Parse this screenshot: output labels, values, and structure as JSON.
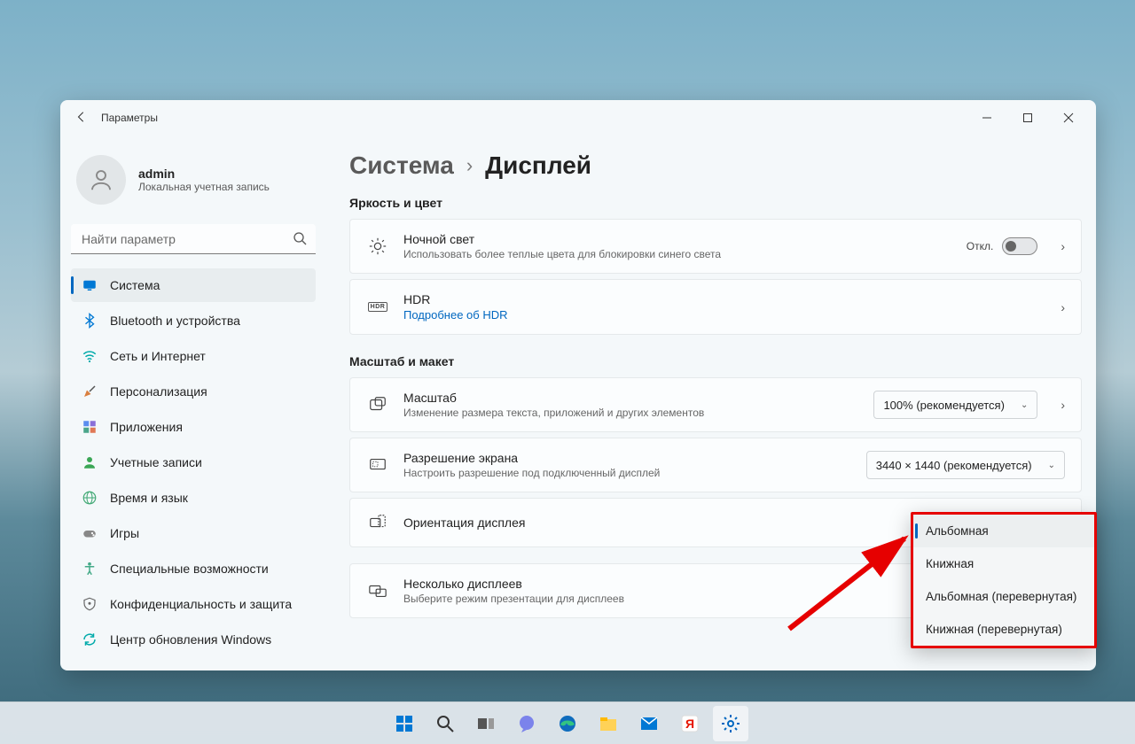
{
  "window": {
    "title": "Параметры"
  },
  "user": {
    "name": "admin",
    "subtitle": "Локальная учетная запись"
  },
  "search": {
    "placeholder": "Найти параметр"
  },
  "nav": [
    {
      "label": "Система",
      "icon": "display",
      "active": true
    },
    {
      "label": "Bluetooth и устройства",
      "icon": "bluetooth"
    },
    {
      "label": "Сеть и Интернет",
      "icon": "wifi"
    },
    {
      "label": "Персонализация",
      "icon": "brush"
    },
    {
      "label": "Приложения",
      "icon": "apps"
    },
    {
      "label": "Учетные записи",
      "icon": "person"
    },
    {
      "label": "Время и язык",
      "icon": "globe"
    },
    {
      "label": "Игры",
      "icon": "gamepad"
    },
    {
      "label": "Специальные возможности",
      "icon": "accessibility"
    },
    {
      "label": "Конфиденциальность и защита",
      "icon": "shield"
    },
    {
      "label": "Центр обновления Windows",
      "icon": "update"
    }
  ],
  "breadcrumb": {
    "parent": "Система",
    "current": "Дисплей"
  },
  "sections": {
    "brightness": "Яркость и цвет",
    "scale": "Масштаб и макет"
  },
  "cards": {
    "nightlight": {
      "title": "Ночной свет",
      "desc": "Использовать более теплые цвета для блокировки синего света",
      "state": "Откл."
    },
    "hdr": {
      "title": "HDR",
      "link": "Подробнее об HDR"
    },
    "scale": {
      "title": "Масштаб",
      "desc": "Изменение размера текста, приложений и других элементов",
      "value": "100% (рекомендуется)"
    },
    "resolution": {
      "title": "Разрешение экрана",
      "desc": "Настроить разрешение под подключенный дисплей",
      "value": "3440 × 1440 (рекомендуется)"
    },
    "orientation": {
      "title": "Ориентация дисплея"
    },
    "multi": {
      "title": "Несколько дисплеев",
      "desc": "Выберите режим презентации для дисплеев"
    }
  },
  "orientation_options": [
    "Альбомная",
    "Книжная",
    "Альбомная (перевернутая)",
    "Книжная (перевернутая)"
  ]
}
